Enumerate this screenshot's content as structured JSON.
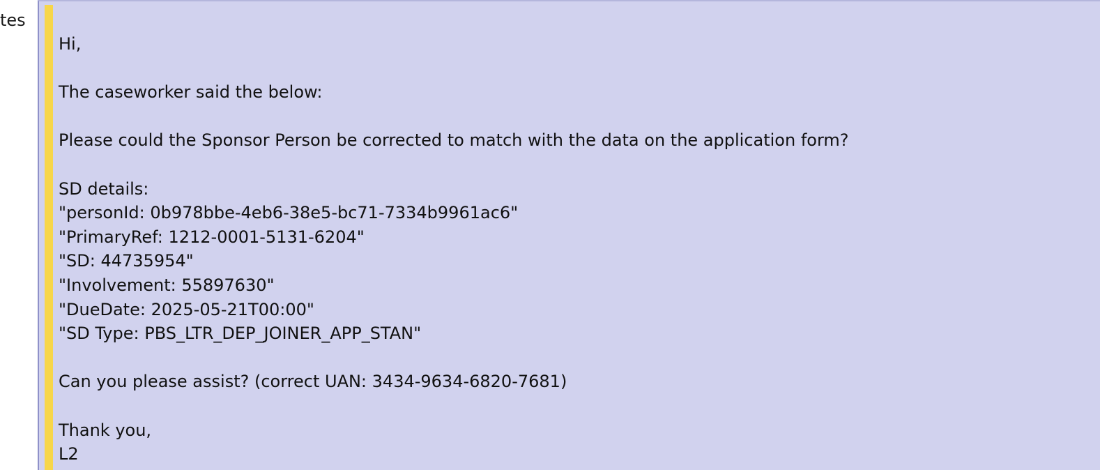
{
  "side_label": "tes",
  "message": {
    "lines": [
      "Hi,",
      "",
      "The caseworker said the below:",
      "",
      "Please could the Sponsor Person be corrected to match with the data on the application form?",
      "",
      "SD details:",
      "\"personId: 0b978bbe-4eb6-38e5-bc71-7334b9961ac6\"",
      "\"PrimaryRef: 1212-0001-5131-6204\"",
      "\"SD: 44735954\"",
      "\"Involvement: 55897630\"",
      "\"DueDate: 2025-05-21T00:00\"",
      "\"SD Type: PBS_LTR_DEP_JOINER_APP_STAN\"",
      "",
      "Can you please assist? (correct UAN: 3434-9634-6820-7681)",
      "",
      "Thank you,",
      "L2"
    ]
  }
}
